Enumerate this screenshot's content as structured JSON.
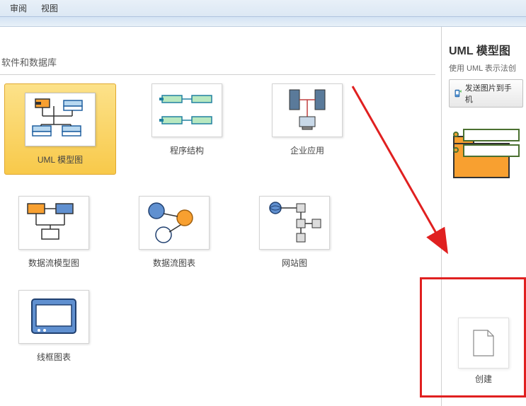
{
  "menu": {
    "items": [
      "审阅",
      "视图"
    ]
  },
  "category": {
    "title": "软件和数据库"
  },
  "templates": [
    {
      "label": "UML 模型图",
      "selected": true
    },
    {
      "label": "程序结构",
      "selected": false
    },
    {
      "label": "企业应用",
      "selected": false
    },
    {
      "label": "数据流模型图",
      "selected": false
    },
    {
      "label": "数据流图表",
      "selected": false
    },
    {
      "label": "网站图",
      "selected": false
    },
    {
      "label": "线框图表",
      "selected": false
    }
  ],
  "right": {
    "title": "UML 模型图",
    "description": "使用 UML 表示法创",
    "send_button": "发送图片到手机",
    "create_label": "创建"
  }
}
